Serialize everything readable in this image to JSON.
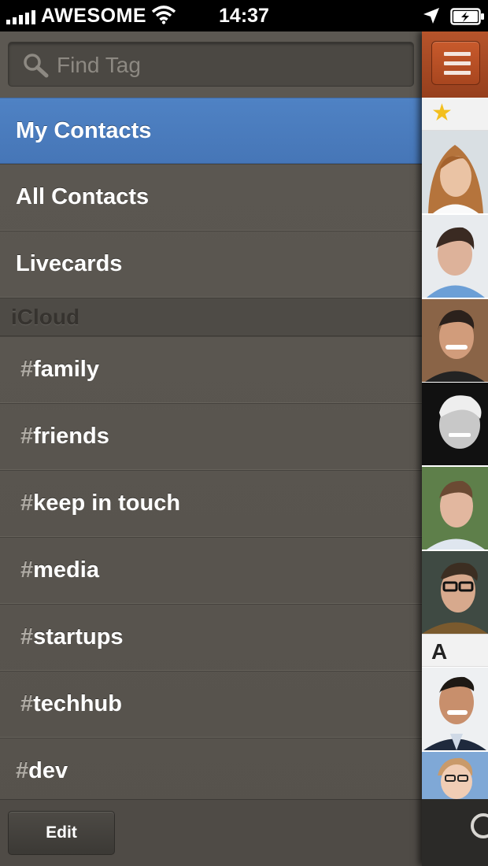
{
  "status_bar": {
    "carrier": "AWESOME",
    "time": "14:37"
  },
  "search": {
    "placeholder": "Find Tag"
  },
  "nav": {
    "items": [
      {
        "label": "My Contacts",
        "selected": true
      },
      {
        "label": "All Contacts",
        "selected": false
      },
      {
        "label": "Livecards",
        "selected": false
      }
    ]
  },
  "section": {
    "title": "iCloud"
  },
  "tags": {
    "hash": "#",
    "items": [
      {
        "label": "family"
      },
      {
        "label": "friends"
      },
      {
        "label": "keep in touch"
      },
      {
        "label": "media"
      },
      {
        "label": "startups"
      },
      {
        "label": "techhub"
      },
      {
        "label": "dev"
      }
    ]
  },
  "footer": {
    "edit_label": "Edit"
  },
  "contacts_peek": {
    "section_letter": "A",
    "accent_color": "#4b7dbe",
    "menu_color": "#b84f24",
    "star_color": "#f3bf1e"
  }
}
